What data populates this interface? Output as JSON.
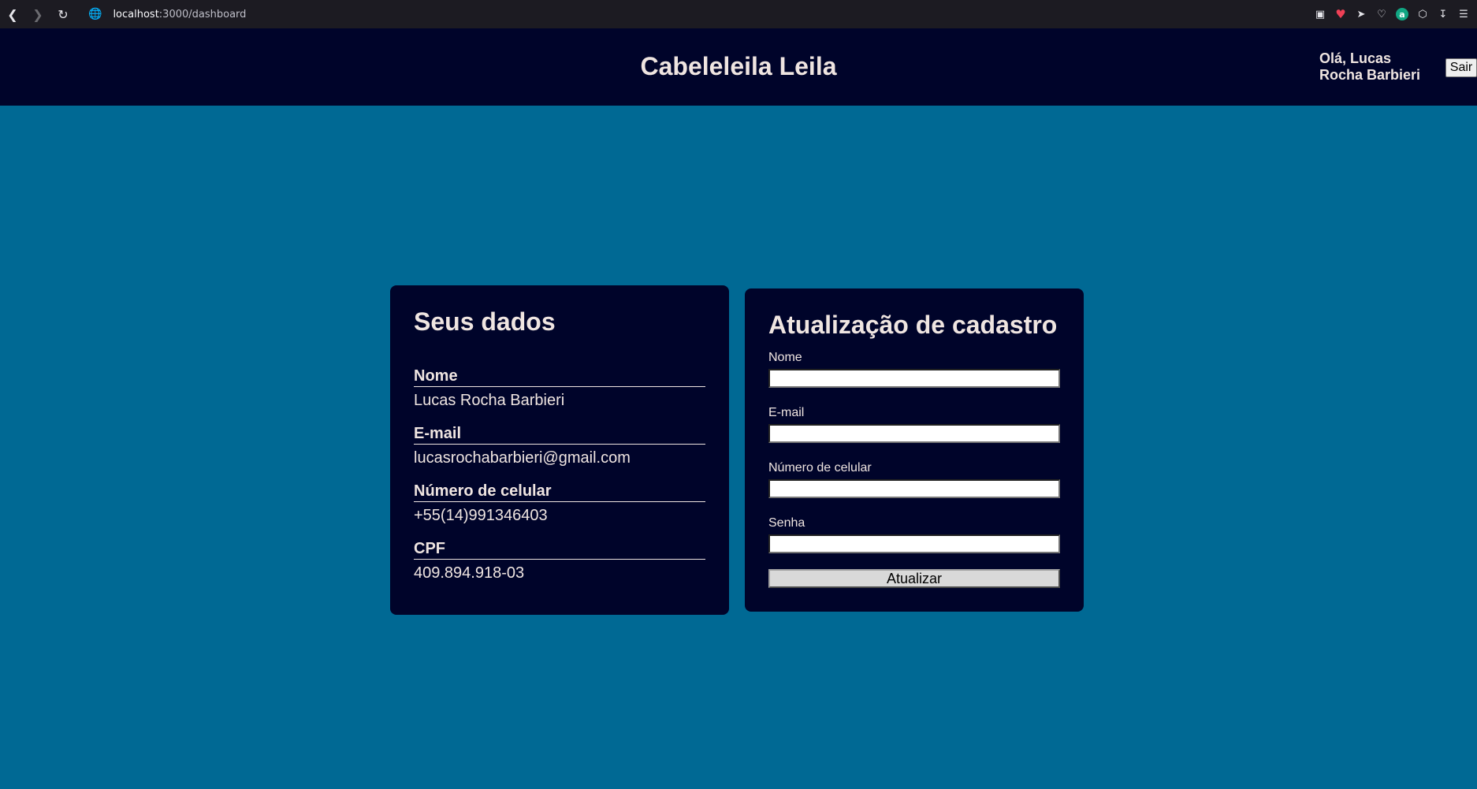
{
  "browser": {
    "url_host": "localhost",
    "url_path": ":3000/dashboard",
    "icons": [
      "back-icon",
      "forward-icon",
      "reload-icon",
      "globe-icon",
      "screenshot-icon",
      "pocket-icon",
      "send-icon",
      "heart-icon",
      "extension-a-icon",
      "cube-icon",
      "download-icon",
      "menu-icon"
    ]
  },
  "header": {
    "title": "Cabeleleila Leila",
    "greeting": "Olá, Lucas Rocha Barbieri",
    "logout_label": "Sair"
  },
  "user_data": {
    "title": "Seus dados",
    "fields": [
      {
        "label": "Nome",
        "value": "Lucas Rocha Barbieri"
      },
      {
        "label": "E-mail",
        "value": "lucasrochabarbieri@gmail.com"
      },
      {
        "label": "Número de celular",
        "value": "+55(14)991346403"
      },
      {
        "label": "CPF",
        "value": "409.894.918-03"
      }
    ]
  },
  "update_form": {
    "title": "Atualização de cadastro",
    "fields": [
      {
        "label": "Nome",
        "value": ""
      },
      {
        "label": "E-mail",
        "value": ""
      },
      {
        "label": "Número de celular",
        "value": ""
      },
      {
        "label": "Senha",
        "value": ""
      }
    ],
    "submit_label": "Atualizar"
  },
  "colors": {
    "page_background": "#006994",
    "header_background": "#00042a",
    "card_background": "#00042a",
    "text": "#efe5e1"
  }
}
